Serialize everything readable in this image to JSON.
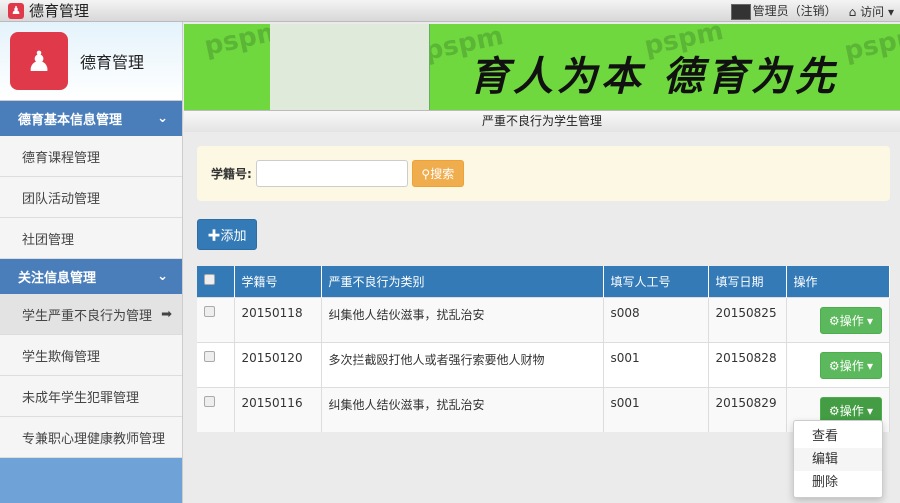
{
  "app": {
    "title": "德育管理",
    "user": "管理员（注销）",
    "visit": "访问"
  },
  "sidebar": {
    "logo_text": "德育管理",
    "sections": [
      {
        "label": "德育基本信息管理",
        "items": [
          "德育课程管理",
          "团队活动管理",
          "社团管理"
        ]
      },
      {
        "label": "关注信息管理",
        "items": [
          "学生严重不良行为管理",
          "学生欺侮管理",
          "未成年学生犯罪管理",
          "专兼职心理健康教师管理"
        ]
      }
    ],
    "active_item": "学生严重不良行为管理"
  },
  "banner": {
    "slogan": "育人为本 德育为先",
    "watermark": "pspm"
  },
  "page": {
    "title": "严重不良行为学生管理"
  },
  "search": {
    "label": "学籍号:",
    "value": "",
    "button": "搜索"
  },
  "add_button": "添加",
  "table": {
    "headers": [
      "学籍号",
      "严重不良行为类别",
      "填写人工号",
      "填写日期",
      "操作"
    ],
    "rows": [
      {
        "id": "20150118",
        "type": "纠集他人结伙滋事，扰乱治安",
        "staff": "s008",
        "date": "20150825",
        "action": "操作"
      },
      {
        "id": "20150120",
        "type": "多次拦截殴打他人或者强行索要他人财物",
        "staff": "s001",
        "date": "20150828",
        "action": "操作"
      },
      {
        "id": "20150116",
        "type": "纠集他人结伙滋事，扰乱治安",
        "staff": "s001",
        "date": "20150829",
        "action": "操作"
      }
    ]
  },
  "dropdown": {
    "items": [
      "查看",
      "编辑",
      "删除"
    ],
    "highlighted": "编辑"
  },
  "colors": {
    "primary": "#337ab7",
    "success": "#5cb85c",
    "warning": "#f0ad4e",
    "banner": "#6ed83e"
  }
}
